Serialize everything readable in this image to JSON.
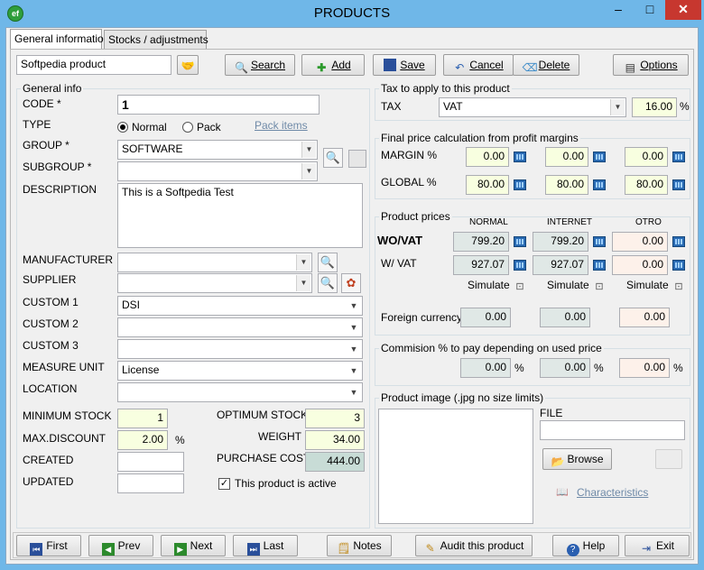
{
  "window": {
    "title": "PRODUCTS",
    "min": "–",
    "max": "□",
    "close": "✕"
  },
  "tabs": [
    "General information",
    "Stocks / adjustments"
  ],
  "toolbar": {
    "search_value": "Softpedia product",
    "search": "Search",
    "add": "Add",
    "save": "Save",
    "cancel": "Cancel",
    "delete": "Delete",
    "options": "Options"
  },
  "general": {
    "section": "General info",
    "code_label": "CODE *",
    "code": "1",
    "type_label": "TYPE",
    "type_normal": "Normal",
    "type_pack": "Pack",
    "pack_items": "Pack items",
    "group_label": "GROUP *",
    "group": "SOFTWARE",
    "subgroup_label": "SUBGROUP *",
    "subgroup": "",
    "description_label": "DESCRIPTION",
    "description": "This is a Softpedia Test",
    "manufacturer_label": "MANUFACTURER",
    "manufacturer": "",
    "supplier_label": "SUPPLIER",
    "supplier": "",
    "custom1_label": "CUSTOM 1",
    "custom1": "DSI",
    "custom2_label": "CUSTOM 2",
    "custom2": "",
    "custom3_label": "CUSTOM 3",
    "custom3": "",
    "measure_label": "MEASURE UNIT",
    "measure": "License",
    "location_label": "LOCATION",
    "location": "",
    "min_stock_label": "MINIMUM STOCK",
    "min_stock": "1",
    "max_discount_label": "MAX.DISCOUNT",
    "max_discount": "2.00",
    "pct": "%",
    "created_label": "CREATED",
    "created": "",
    "updated_label": "UPDATED",
    "updated": "",
    "opt_stock_label": "OPTIMUM STOCK",
    "opt_stock": "3",
    "weight_label": "WEIGHT",
    "weight": "34.00",
    "purchase_label": "PURCHASE COST",
    "purchase": "444.00",
    "active_label": "This product is active",
    "active_check": "✓"
  },
  "tax": {
    "section": "Tax to apply to this product",
    "label": "TAX",
    "value": "VAT",
    "rate": "16.00",
    "pct": "%"
  },
  "margins": {
    "section": "Final price calculation from profit margins",
    "margin_label": "MARGIN %",
    "margin": [
      "0.00",
      "0.00",
      "0.00"
    ],
    "global_label": "GLOBAL %",
    "global": [
      "80.00",
      "80.00",
      "80.00"
    ]
  },
  "prices": {
    "section": "Product prices",
    "columns": [
      "NORMAL",
      "INTERNET",
      "OTRO"
    ],
    "wovat_label": "WO/VAT",
    "wovat": [
      "799.20",
      "799.20",
      "0.00"
    ],
    "wvat_label": "W/ VAT",
    "wvat": [
      "927.07",
      "927.07",
      "0.00"
    ],
    "simulate": [
      "Simulate",
      "Simulate",
      "Simulate"
    ],
    "foreign_label": "Foreign currency",
    "foreign": [
      "0.00",
      "0.00",
      "0.00"
    ]
  },
  "commission": {
    "section": "Commision % to pay depending on used price",
    "values": [
      "0.00",
      "0.00",
      "0.00"
    ],
    "pct": "%"
  },
  "image": {
    "section": "Product image (.jpg no size limits)",
    "file_label": "FILE",
    "file": "",
    "browse": "Browse",
    "characteristics": "Characteristics"
  },
  "footer": {
    "first": "First",
    "prev": "Prev",
    "next": "Next",
    "last": "Last",
    "notes": "Notes",
    "audit": "Audit this product",
    "help": "Help",
    "exit": "Exit"
  }
}
